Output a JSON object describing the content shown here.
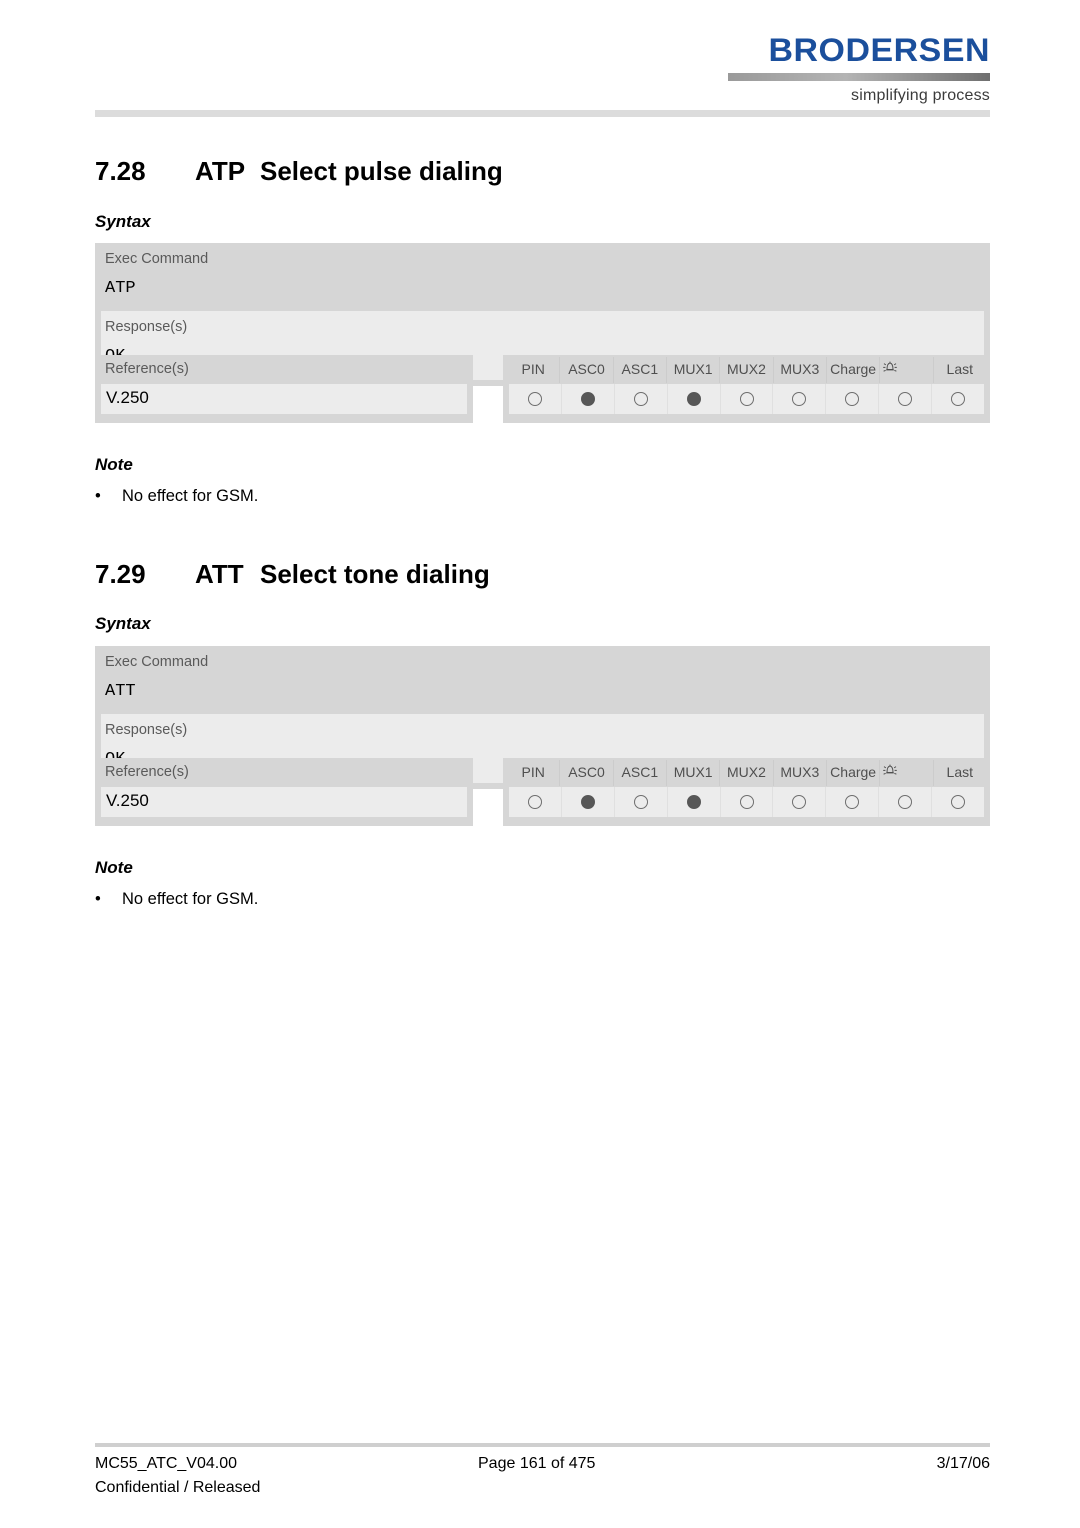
{
  "header": {
    "logo_word": "BRODERSEN",
    "logo_tagline": "simplifying process",
    "logo_color": "#1b4f9c"
  },
  "sections": [
    {
      "number": "7.28",
      "command": "ATP",
      "title": "Select pulse dialing",
      "syntax_label": "Syntax",
      "syntax": {
        "exec_label": "Exec Command",
        "exec_value": "ATP",
        "response_label": "Response(s)",
        "response_value": "OK"
      },
      "references": {
        "label": "Reference(s)",
        "value": "V.250"
      },
      "flags": {
        "columns": [
          "PIN",
          "ASC0",
          "ASC1",
          "MUX1",
          "MUX2",
          "MUX3",
          "Charge",
          "alarm-bell-icon",
          "Last"
        ],
        "states": [
          "empty",
          "filled",
          "empty",
          "filled",
          "empty",
          "empty",
          "empty",
          "empty",
          "empty"
        ]
      },
      "note_label": "Note",
      "notes": [
        "No effect for GSM."
      ]
    },
    {
      "number": "7.29",
      "command": "ATT",
      "title": "Select tone dialing",
      "syntax_label": "Syntax",
      "syntax": {
        "exec_label": "Exec Command",
        "exec_value": "ATT",
        "response_label": "Response(s)",
        "response_value": "OK"
      },
      "references": {
        "label": "Reference(s)",
        "value": "V.250"
      },
      "flags": {
        "columns": [
          "PIN",
          "ASC0",
          "ASC1",
          "MUX1",
          "MUX2",
          "MUX3",
          "Charge",
          "alarm-bell-icon",
          "Last"
        ],
        "states": [
          "empty",
          "filled",
          "empty",
          "filled",
          "empty",
          "empty",
          "empty",
          "empty",
          "empty"
        ]
      },
      "note_label": "Note",
      "notes": [
        "No effect for GSM."
      ]
    }
  ],
  "bullet_char": "•",
  "footer": {
    "document_id": "MC55_ATC_V04.00",
    "classification": "Confidential / Released",
    "page_info": "Page 161 of 475",
    "date": "3/17/06"
  }
}
